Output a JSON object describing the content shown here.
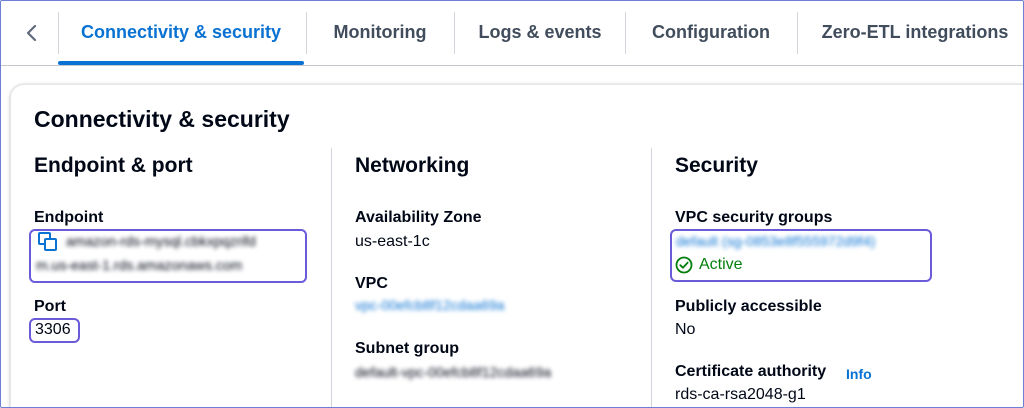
{
  "tabs": {
    "back_icon": "chevron-left-icon",
    "items": [
      {
        "label": "Connectivity & security",
        "active": true
      },
      {
        "label": "Monitoring",
        "active": false
      },
      {
        "label": "Logs & events",
        "active": false
      },
      {
        "label": "Configuration",
        "active": false
      },
      {
        "label": "Zero-ETL integrations",
        "active": false
      }
    ]
  },
  "panel": {
    "title": "Connectivity & security",
    "endpoint_port": {
      "heading": "Endpoint & port",
      "endpoint_label": "Endpoint",
      "endpoint_value_line1": "amazon-rds-mysql.cbkxpqzrifd",
      "endpoint_value_line2": "m.us-east-1.rds.amazonaws.com",
      "port_label": "Port",
      "port_value": "3306"
    },
    "networking": {
      "heading": "Networking",
      "az_label": "Availability Zone",
      "az_value": "us-east-1c",
      "vpc_label": "VPC",
      "vpc_value": "vpc-00efcb8f12cdaa69a",
      "subnet_label": "Subnet group",
      "subnet_value": "default-vpc-00efcb8f12cdaa69a"
    },
    "security": {
      "heading": "Security",
      "sg_label": "VPC security groups",
      "sg_value": "default (sg-0853e8f555972d9f4)",
      "sg_status": "Active",
      "public_label": "Publicly accessible",
      "public_value": "No",
      "ca_label": "Certificate authority",
      "ca_info": "Info",
      "ca_value": "rds-ca-rsa2048-g1"
    }
  },
  "colors": {
    "accent": "#0972d3",
    "success": "#037f0c",
    "highlight": "#6b5bd8"
  }
}
